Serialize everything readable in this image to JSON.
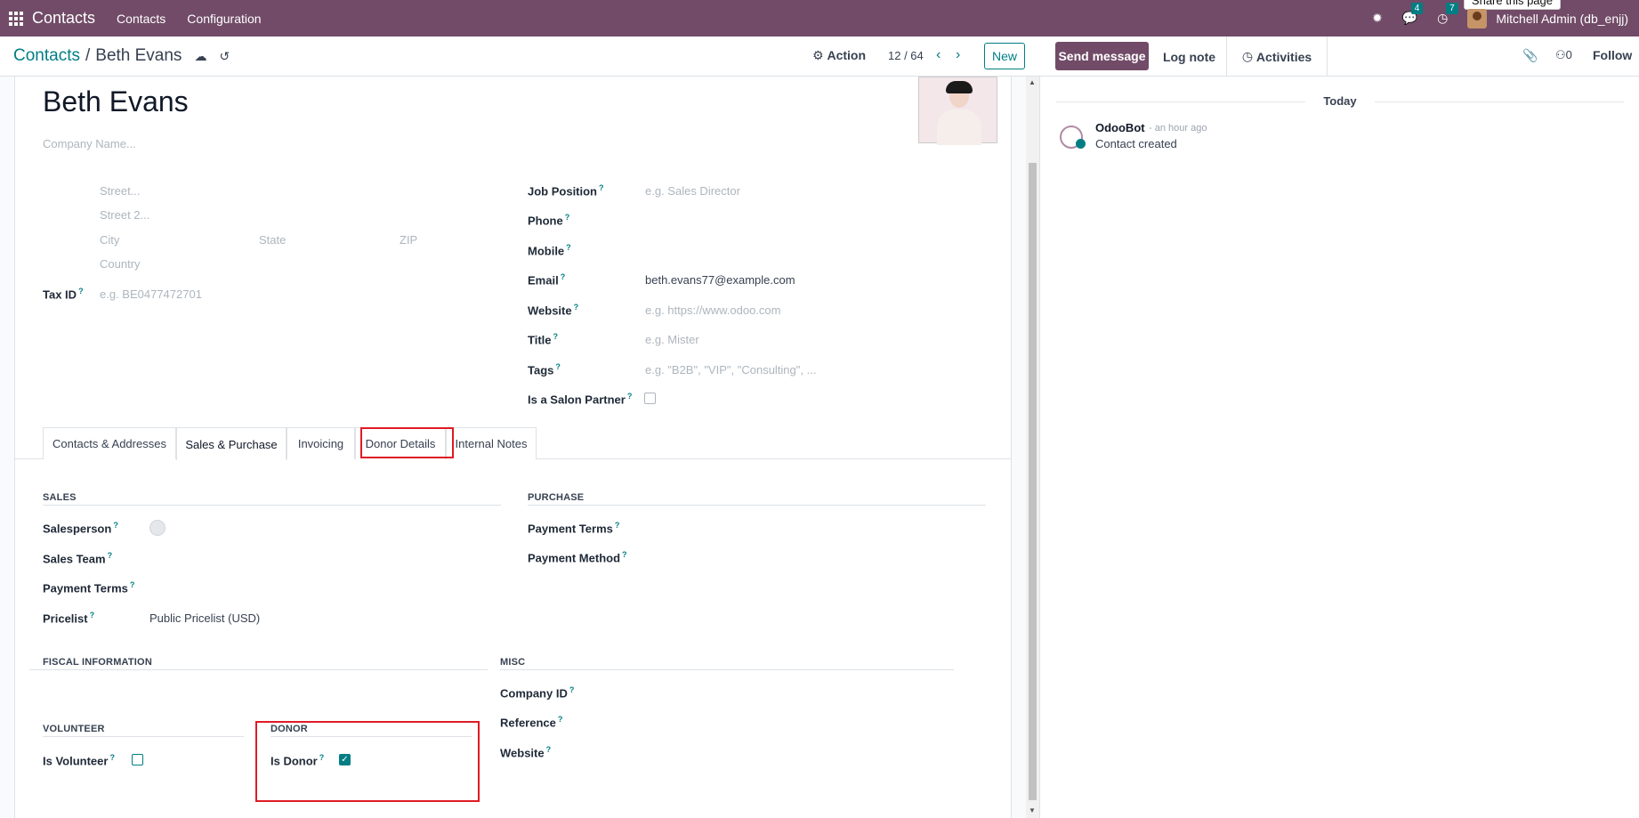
{
  "navbar": {
    "app_name": "Contacts",
    "menu": [
      "Contacts",
      "Configuration"
    ],
    "messages_count": "4",
    "activities_count": "7",
    "user": "Mitchell Admin (db_enjj)",
    "tooltip": "Share this page"
  },
  "control": {
    "breadcrumb_root": "Contacts",
    "breadcrumb_sep": "/",
    "breadcrumb_current": "Beth Evans",
    "action_label": "Action",
    "pager": "12 / 64",
    "new_label": "New"
  },
  "chatter": {
    "send_message": "Send message",
    "log_note": "Log note",
    "activities": "Activities",
    "followers_count": "0",
    "follow": "Follow",
    "date_separator": "Today",
    "messages": [
      {
        "author": "OdooBot",
        "time": "- an hour ago",
        "body": "Contact created"
      }
    ]
  },
  "form": {
    "name": "Beth Evans",
    "company_placeholder": "Company Name...",
    "address": {
      "street": "Street...",
      "street2": "Street 2...",
      "city": "City",
      "state": "State",
      "zip": "ZIP",
      "country": "Country"
    },
    "tax_id_label": "Tax ID",
    "tax_id_placeholder": "e.g. BE0477472701",
    "right_fields": {
      "job_position": {
        "label": "Job Position",
        "placeholder": "e.g. Sales Director"
      },
      "phone": {
        "label": "Phone"
      },
      "mobile": {
        "label": "Mobile"
      },
      "email": {
        "label": "Email",
        "value": "beth.evans77@example.com"
      },
      "website": {
        "label": "Website",
        "placeholder": "e.g. https://www.odoo.com"
      },
      "title": {
        "label": "Title",
        "placeholder": "e.g. Mister"
      },
      "tags": {
        "label": "Tags",
        "placeholder": "e.g. \"B2B\", \"VIP\", \"Consulting\", ..."
      },
      "salon_partner": {
        "label": "Is a Salon Partner",
        "checked": false
      }
    },
    "tabs": [
      "Contacts & Addresses",
      "Sales & Purchase",
      "Invoicing",
      "Donor Details",
      "Internal Notes"
    ],
    "active_tab": "Sales & Purchase",
    "sales": {
      "title": "SALES",
      "salesperson": "Salesperson",
      "sales_team": "Sales Team",
      "payment_terms": "Payment Terms",
      "pricelist": "Pricelist",
      "pricelist_value": "Public Pricelist (USD)"
    },
    "purchase": {
      "title": "PURCHASE",
      "payment_terms": "Payment Terms",
      "payment_method": "Payment Method"
    },
    "fiscal": {
      "title": "FISCAL INFORMATION"
    },
    "misc": {
      "title": "MISC",
      "company_id": "Company ID",
      "reference": "Reference",
      "website": "Website"
    },
    "volunteer": {
      "title": "VOLUNTEER",
      "label": "Is Volunteer",
      "checked": false
    },
    "donor": {
      "title": "DONOR",
      "label": "Is Donor",
      "checked": true
    }
  },
  "colors": {
    "brand": "#714b67",
    "accent": "#017e84",
    "highlight": "#e01b24"
  }
}
